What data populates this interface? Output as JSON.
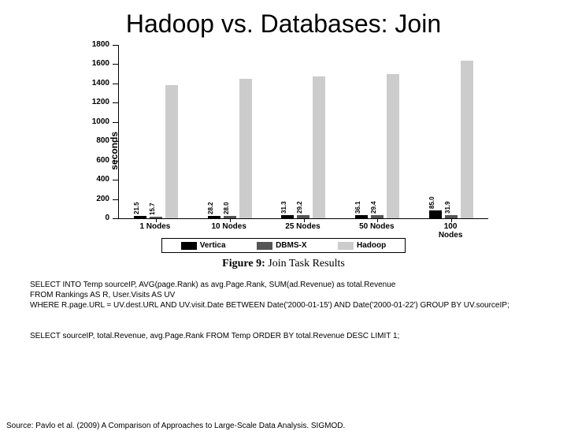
{
  "title": "Hadoop vs. Databases: Join",
  "caption_prefix": "Figure 9:",
  "caption_rest": " Join Task Results",
  "ylabel": "seconds",
  "legend": {
    "vertica": "Vertica",
    "dbmsx": "DBMS-X",
    "hadoop": "Hadoop"
  },
  "sql1": "SELECT INTO Temp sourceIP, AVG(page.Rank) as avg.Page.Rank, SUM(ad.Revenue) as total.Revenue\nFROM Rankings AS R, User.Visits AS UV\nWHERE R.page.URL = UV.dest.URL AND UV.visit.Date BETWEEN Date('2000-01-15') AND Date('2000-01-22') GROUP BY UV.sourceIP;",
  "sql2": "SELECT sourceIP, total.Revenue, avg.Page.Rank FROM Temp ORDER BY total.Revenue DESC LIMIT 1;",
  "source": "Source: Pavlo et al. (2009) A Comparison of Approaches to Large-Scale Data Analysis. SIGMOD.",
  "chart_data": {
    "type": "bar",
    "title": "Hadoop vs. Databases: Join",
    "xlabel": "",
    "ylabel": "seconds",
    "ylim": [
      0,
      1800
    ],
    "yticks": [
      0,
      200,
      400,
      600,
      800,
      1000,
      1200,
      1400,
      1600,
      1800
    ],
    "categories": [
      "1 Nodes",
      "10 Nodes",
      "25 Nodes",
      "50 Nodes",
      "100 Nodes"
    ],
    "series": [
      {
        "name": "Vertica",
        "values": [
          21.5,
          28.2,
          31.3,
          36.1,
          85.0
        ],
        "labels": [
          "21.5",
          "28.2",
          "31.3",
          "36.1",
          "85.0"
        ]
      },
      {
        "name": "DBMS-X",
        "values": [
          15.7,
          28.0,
          29.2,
          29.4,
          31.9
        ],
        "labels": [
          "15.7",
          "28.0",
          "29.2",
          "29.4",
          "31.9"
        ]
      },
      {
        "name": "Hadoop",
        "values": [
          1380,
          1450,
          1470,
          1500,
          1640
        ],
        "labels": [
          "",
          "",
          "",
          "",
          ""
        ]
      }
    ],
    "legend_position": "bottom",
    "grid": false
  }
}
